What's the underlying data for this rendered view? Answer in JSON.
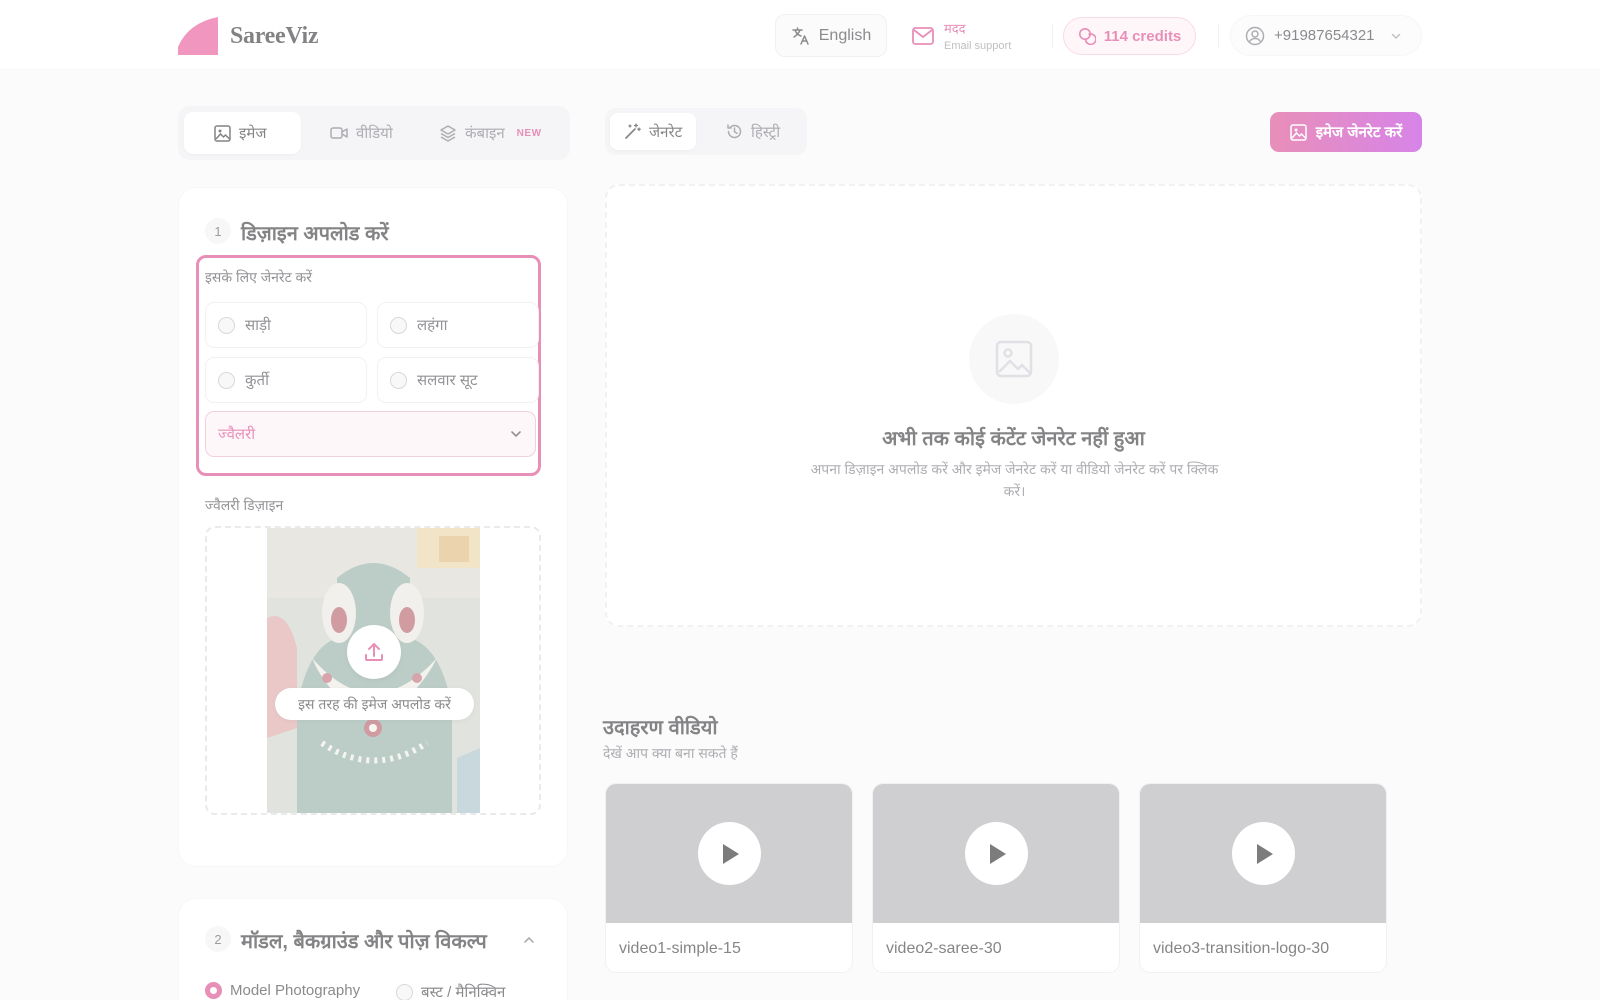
{
  "header": {
    "brand": "SareeViz",
    "language_label": "English",
    "help_label": "मदद",
    "help_sub": "Email support",
    "credits_label": "114 credits",
    "phone": "+91987654321"
  },
  "mode_tabs": [
    {
      "label": "इमेज",
      "icon": "image-icon"
    },
    {
      "label": "वीडियो",
      "icon": "video-icon"
    },
    {
      "label": "कंबाइन",
      "icon": "layers-icon",
      "badge": "NEW"
    }
  ],
  "step1": {
    "number": "1",
    "title": "डिज़ाइन अपलोड करें",
    "generate_for_label": "इसके लिए जेनरेट करें",
    "options": [
      "साड़ी",
      "लहंगा",
      "कुर्ती",
      "सलवार सूट"
    ],
    "selected_value": "ज्वैलरी",
    "design_label": "ज्वैलरी डिज़ाइन",
    "upload_hint": "इस तरह की इमेज अपलोड करें"
  },
  "step2": {
    "number": "2",
    "title": "मॉडल, बैकग्राउंड और पोज़ विकल्प",
    "options": [
      "Model Photography",
      "बस्ट / मैनिक्विन"
    ]
  },
  "gen_tabs": [
    {
      "label": "जेनरेट",
      "icon": "magic-wand-icon"
    },
    {
      "label": "हिस्ट्री",
      "icon": "history-icon"
    }
  ],
  "generate_button": "इमेज जेनरेट करें",
  "output": {
    "empty_title": "अभी तक कोई कंटेंट जेनरेट नहीं हुआ",
    "empty_desc": "अपना डिज़ाइन अपलोड करें और इमेज जेनरेट करें या वीडियो जेनरेट करें पर क्लिक करें।"
  },
  "examples": {
    "title": "उदाहरण वीडियो",
    "subtitle": "देखें आप क्या बना सकते हैं",
    "videos": [
      "video1-simple-15",
      "video2-saree-30",
      "video3-transition-logo-30"
    ]
  },
  "colors": {
    "accent": "#d6337f",
    "accent_2": "#b620d6"
  }
}
